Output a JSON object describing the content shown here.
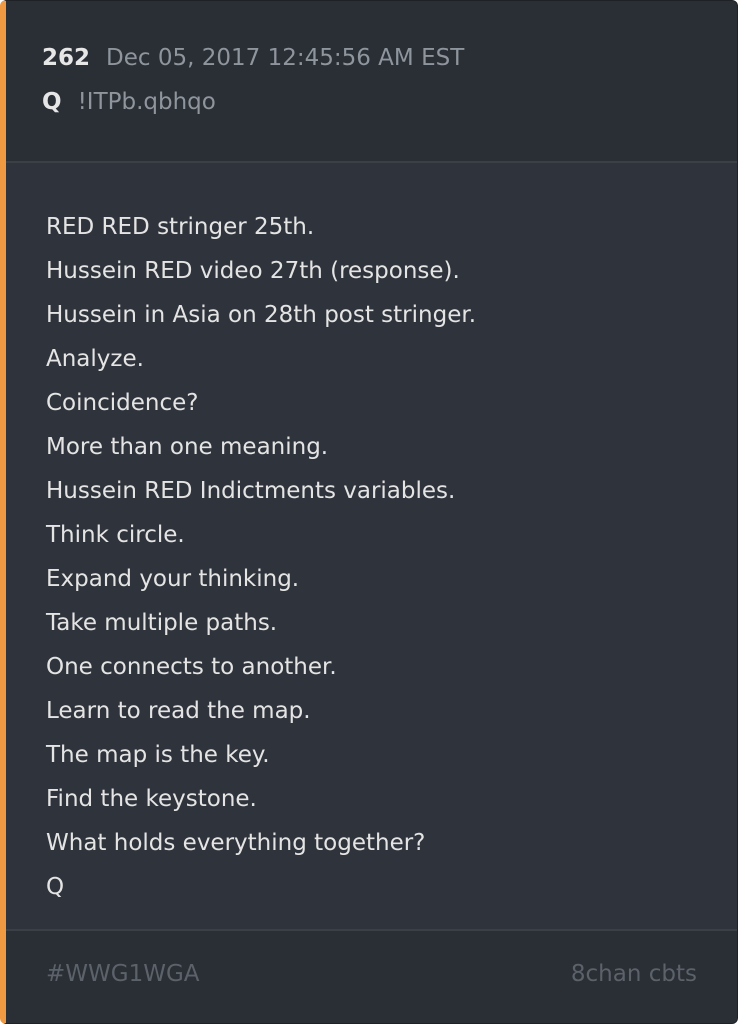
{
  "post": {
    "number": "262",
    "timestamp": "Dec 05, 2017 12:45:56 AM EST",
    "author": "Q",
    "tripcode": "!ITPb.qbhqo",
    "lines": [
      "RED RED stringer 25th.",
      "Hussein RED video 27th (response).",
      "Hussein in Asia on 28th post stringer.",
      "Analyze.",
      "Coincidence?",
      "More than one meaning.",
      "Hussein RED Indictments variables.",
      "Think circle.",
      "Expand your thinking.",
      "Take multiple paths.",
      "One connects to another.",
      "Learn to read the map.",
      "The map is the key.",
      "Find the keystone.",
      "What holds everything together?",
      "Q"
    ]
  },
  "footer": {
    "hashtag": "#WWG1WGA",
    "source": "8chan cbts"
  },
  "colors": {
    "card_background": "#2f343c",
    "header_background": "#2a2e35",
    "accent_border": "#ef9a43",
    "text_primary": "#e4e4e4",
    "text_muted": "#8e959d",
    "text_faint": "#5c626a"
  }
}
